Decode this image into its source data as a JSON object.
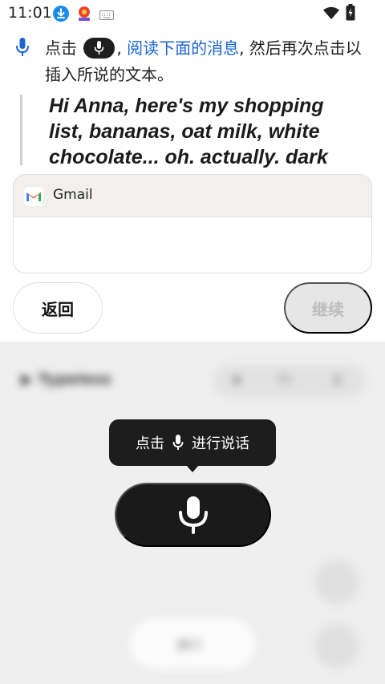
{
  "status_bar": {
    "time": "11:01",
    "icons": [
      "download-icon",
      "app-notification-icon",
      "keyboard-icon",
      "wifi-icon",
      "battery-charging-icon"
    ]
  },
  "instruction": {
    "part1": "点击 ",
    "part2": ", ",
    "link": "阅读下面的消息",
    "part3": ", 然后再次点击以插入所说的文本。"
  },
  "quote": {
    "text": "Hi Anna, here's my shopping list, bananas, oat milk, white chocolate... oh. actually. dark"
  },
  "gmail": {
    "app_name": "Gmail"
  },
  "buttons": {
    "back": "返回",
    "continue": "继续"
  },
  "keyboard": {
    "brand": "Typeless",
    "toggle_label": "EN",
    "enter_label": "换行",
    "tooltip_part1": "点击",
    "tooltip_part2": "进行说话"
  },
  "colors": {
    "link": "#1a66d6",
    "dark": "#1a1a1a",
    "keyboard_bg": "#efefef",
    "disabled_text": "#bdbdbd"
  }
}
